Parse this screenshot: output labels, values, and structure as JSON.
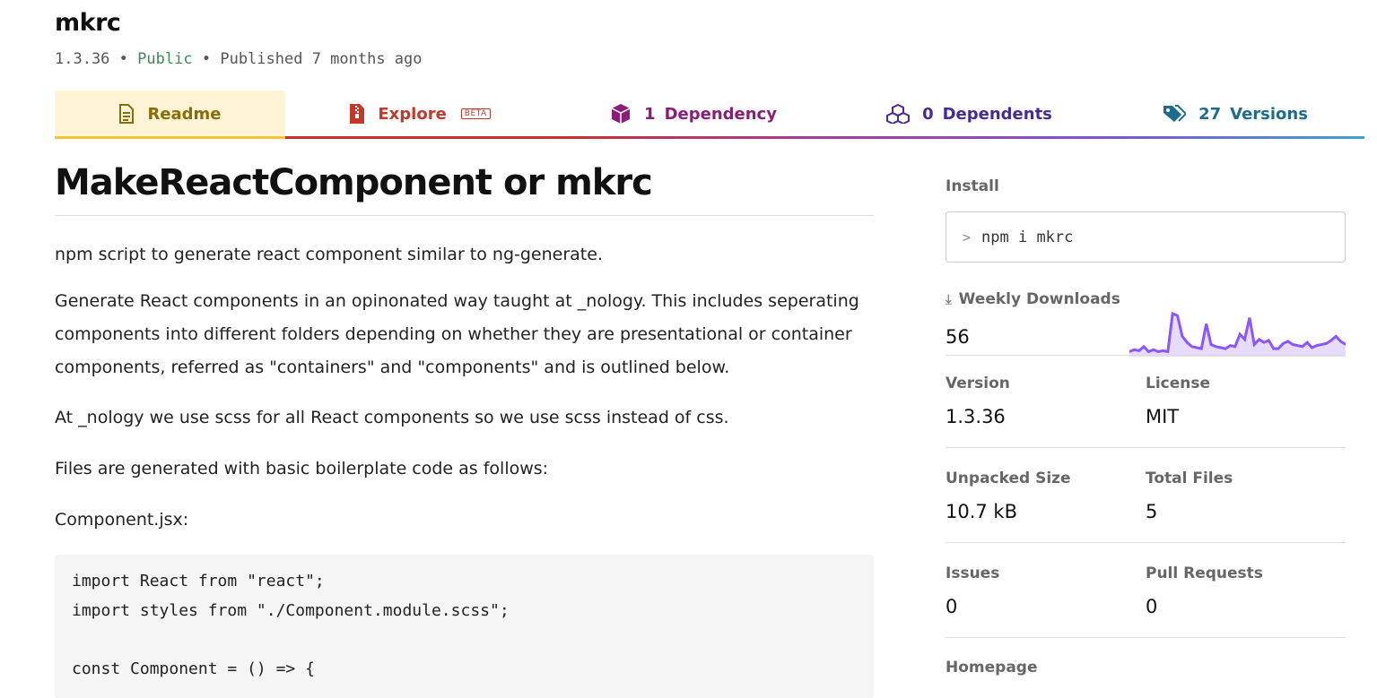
{
  "package": {
    "name": "mkrc",
    "version": "1.3.36",
    "visibility": "Public",
    "published": "Published 7 months ago",
    "separator": "•"
  },
  "tabs": {
    "readme": "Readme",
    "explore": "Explore",
    "explore_badge": "BETA",
    "dependency_count": "1",
    "dependency": "Dependency",
    "dependents_count": "0",
    "dependents": "Dependents",
    "versions_count": "27",
    "versions": "Versions"
  },
  "readme": {
    "heading": "MakeReactComponent or mkrc",
    "p1": "npm script to generate react component similar to ng-generate.",
    "p2": "Generate React components in an opinonated way taught at _nology. This includes seperating components into different folders depending on whether they are presentational or container components, referred as \"containers\" and \"components\" and is outlined below.",
    "p3": "At _nology we use scss for all React components so we use scss instead of css.",
    "p4": "Files are generated with basic boilerplate code as follows:",
    "p5": "Component.jsx:",
    "code": [
      "import React from \"react\";",
      "import styles from \"./Component.module.scss\";",
      "",
      "const Component = () => {"
    ]
  },
  "sidebar": {
    "install_label": "Install",
    "install_prompt": ">",
    "install_cmd": "npm i mkrc",
    "downloads_label": "Weekly Downloads",
    "downloads_value": "56",
    "downloads_series": [
      3,
      5,
      4,
      8,
      3,
      5,
      3,
      4,
      3,
      40,
      38,
      18,
      12,
      8,
      7,
      6,
      30,
      10,
      8,
      7,
      6,
      9,
      8,
      20,
      15,
      36,
      10,
      15,
      12,
      14,
      6,
      6,
      11,
      13,
      10,
      9,
      8,
      12,
      7,
      9,
      10,
      11,
      14,
      18,
      13,
      10
    ],
    "accent_color": "#8956ff",
    "version_label": "Version",
    "version_value": "1.3.36",
    "license_label": "License",
    "license_value": "MIT",
    "size_label": "Unpacked Size",
    "size_value": "10.7 kB",
    "files_label": "Total Files",
    "files_value": "5",
    "issues_label": "Issues",
    "issues_value": "0",
    "prs_label": "Pull Requests",
    "prs_value": "0",
    "homepage_label": "Homepage"
  }
}
